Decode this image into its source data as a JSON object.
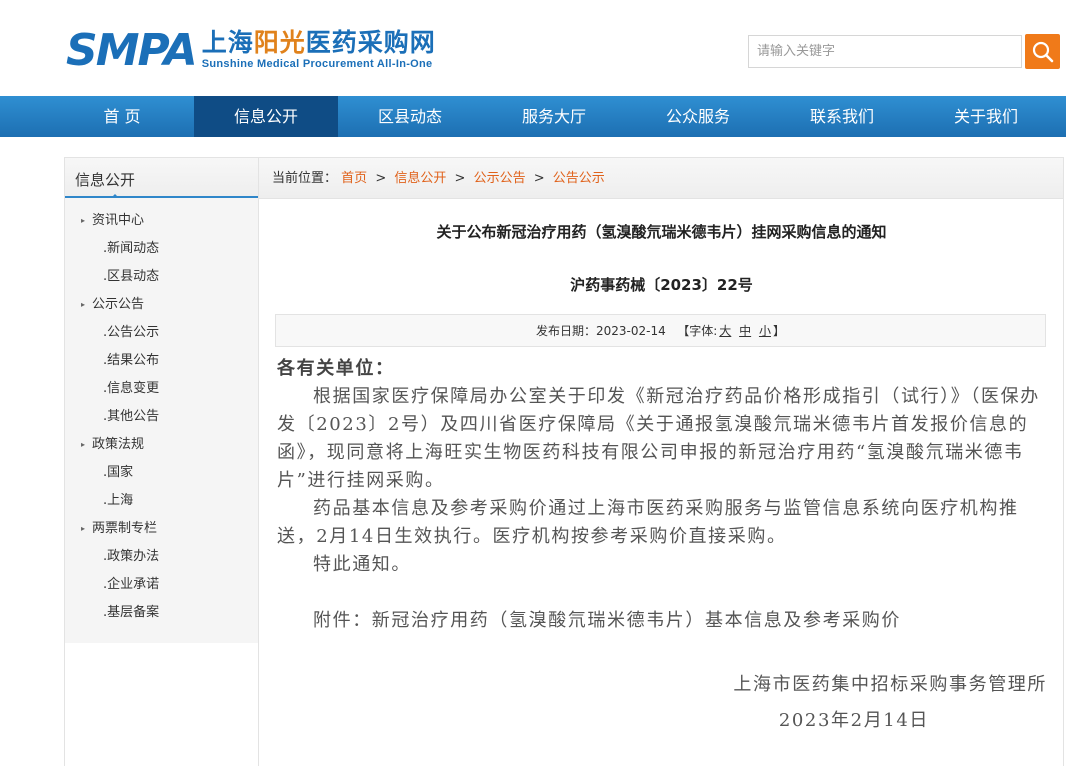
{
  "header": {
    "logo_abbr": "SMPA",
    "logo_cn_pre": "上海",
    "logo_cn_hl": "阳光",
    "logo_cn_post": "医药采购网",
    "logo_en": "Sunshine Medical Procurement All-In-One",
    "search_placeholder": "请输入关键字"
  },
  "nav": [
    "首 页",
    "信息公开",
    "区县动态",
    "服务大厅",
    "公众服务",
    "联系我们",
    "关于我们"
  ],
  "sidebar": {
    "title": "信息公开",
    "items": [
      {
        "label": "资讯中心",
        "level": 1
      },
      {
        "label": ".新闻动态",
        "level": 2
      },
      {
        "label": ".区县动态",
        "level": 2
      },
      {
        "label": "公示公告",
        "level": 1
      },
      {
        "label": ".公告公示",
        "level": 2
      },
      {
        "label": ".结果公布",
        "level": 2
      },
      {
        "label": ".信息变更",
        "level": 2
      },
      {
        "label": ".其他公告",
        "level": 2
      },
      {
        "label": "政策法规",
        "level": 1
      },
      {
        "label": ".国家",
        "level": 2
      },
      {
        "label": ".上海",
        "level": 2
      },
      {
        "label": "两票制专栏",
        "level": 1
      },
      {
        "label": ".政策办法",
        "level": 2
      },
      {
        "label": ".企业承诺",
        "level": 2
      },
      {
        "label": ".基层备案",
        "level": 2
      }
    ]
  },
  "breadcrumb": {
    "prefix": "当前位置：",
    "items": [
      "首页",
      "信息公开",
      "公示公告",
      "公告公示"
    ],
    "sep": ">"
  },
  "article": {
    "title": "关于公布新冠治疗用药（氢溴酸氘瑞米德韦片）挂网采购信息的通知",
    "doc_no": "沪药事药械〔2023〕22号",
    "meta_date_label": "发布日期：2023-02-14",
    "meta_font_label": "【字体:",
    "font_large": "大",
    "font_medium": "中",
    "font_small": "小",
    "meta_close": "】",
    "salutation": "各有关单位：",
    "para1": "根据国家医疗保障局办公室关于印发《新冠治疗药品价格形成指引（试行）》（医保办发〔2023〕2号）及四川省医疗保障局《关于通报氢溴酸氘瑞米德韦片首发报价信息的函》，现同意将上海旺实生物医药科技有限公司申报的新冠治疗用药“氢溴酸氘瑞米德韦片”进行挂网采购。",
    "para2": "药品基本信息及参考采购价通过上海市医药采购服务与监管信息系统向医疗机构推送，2月14日生效执行。医疗机构按参考采购价直接采购。",
    "para3": "特此通知。",
    "attachment": "附件：新冠治疗用药（氢溴酸氘瑞米德韦片）基本信息及参考采购价",
    "signature": "上海市医药集中招标采购事务管理所",
    "sign_date": "2023年2月14日"
  }
}
